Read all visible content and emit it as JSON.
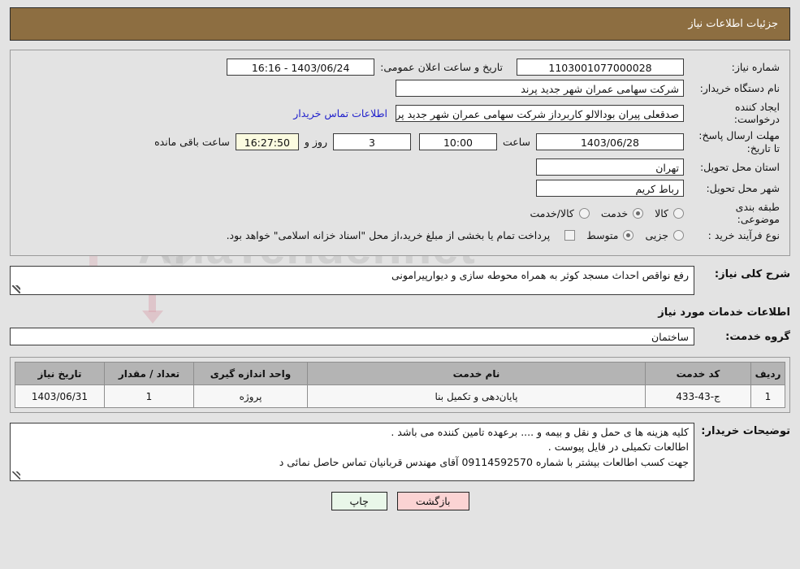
{
  "header": {
    "title": "جزئیات اطلاعات نیاز",
    "bg_color": "#8d6e41"
  },
  "form": {
    "need_number_label": "شماره نیاز:",
    "need_number_value": "1103001077000028",
    "public_announce_label": "تاریخ و ساعت اعلان عمومی:",
    "public_announce_value": "1403/06/24 - 16:16",
    "buyer_org_label": "نام دستگاه خریدار:",
    "buyer_org_value": "شرکت سهامی عمران شهر جدید پرند",
    "request_creator_label": "ایجاد کننده درخواست:",
    "request_creator_value": "صدقعلی پیران بودالالو کاربرداز شرکت سهامی عمران شهر جدید پرند",
    "contact_link": "اطلاعات تماس خریدار",
    "deadline_label": "مهلت ارسال پاسخ: تا تاریخ:",
    "deadline_date": "1403/06/28",
    "hour_label": "ساعت",
    "deadline_time": "10:00",
    "days_value": "3",
    "days_label": "روز و",
    "countdown_value": "16:27:50",
    "countdown_label": "ساعت باقی مانده",
    "province_label": "استان محل تحویل:",
    "province_value": "تهران",
    "city_label": "شهر محل تحویل:",
    "city_value": "رباط کریم",
    "category_label": "طبقه بندی موضوعی:",
    "category_options": [
      {
        "label": "کالا",
        "selected": false
      },
      {
        "label": "خدمت",
        "selected": true
      },
      {
        "label": "کالا/خدمت",
        "selected": false
      }
    ],
    "process_label": "نوع فرآیند خرید :",
    "process_options": [
      {
        "label": "جزیی",
        "selected": false
      },
      {
        "label": "متوسط",
        "selected": true
      }
    ],
    "payment_checkbox_note": "پرداخت تمام یا بخشی از مبلغ خرید،از محل \"اسناد خزانه اسلامی\" خواهد بود."
  },
  "description": {
    "label": "شرح کلی نیاز:",
    "value": "رفع نواقص احداث مسجد کوثر به همراه محوطه سازی و دیوارپیرامونی"
  },
  "services_section": {
    "title": "اطلاعات خدمات مورد نیاز",
    "group_label": "گروه خدمت:",
    "group_value": "ساختمان"
  },
  "table": {
    "columns": [
      "ردیف",
      "کد خدمت",
      "نام خدمت",
      "واحد اندازه گیری",
      "تعداد / مقدار",
      "تاریخ نیاز"
    ],
    "rows": [
      {
        "row_no": "1",
        "service_code": "ج-43-433",
        "service_name": "پایان‌دهی و تکمیل بنا",
        "unit": "پروژه",
        "quantity": "1",
        "need_date": "1403/06/31"
      }
    ]
  },
  "buyer_notes": {
    "label": "توضیحات خریدار:",
    "lines": [
      "کلیه هزینه ها ی حمل و نقل و بیمه و .... برعهده تامین کننده می باشد .",
      "اطالعات تکمیلی در فایل پیوست .",
      "جهت کسب اطالعات بیشتر با شماره 09114592570 آقای مهندس قربانیان تماس حاصل نمائی د"
    ]
  },
  "buttons": {
    "print": "چاپ",
    "back": "بازگشت"
  },
  "watermark": {
    "text": "AriaTender.net"
  }
}
